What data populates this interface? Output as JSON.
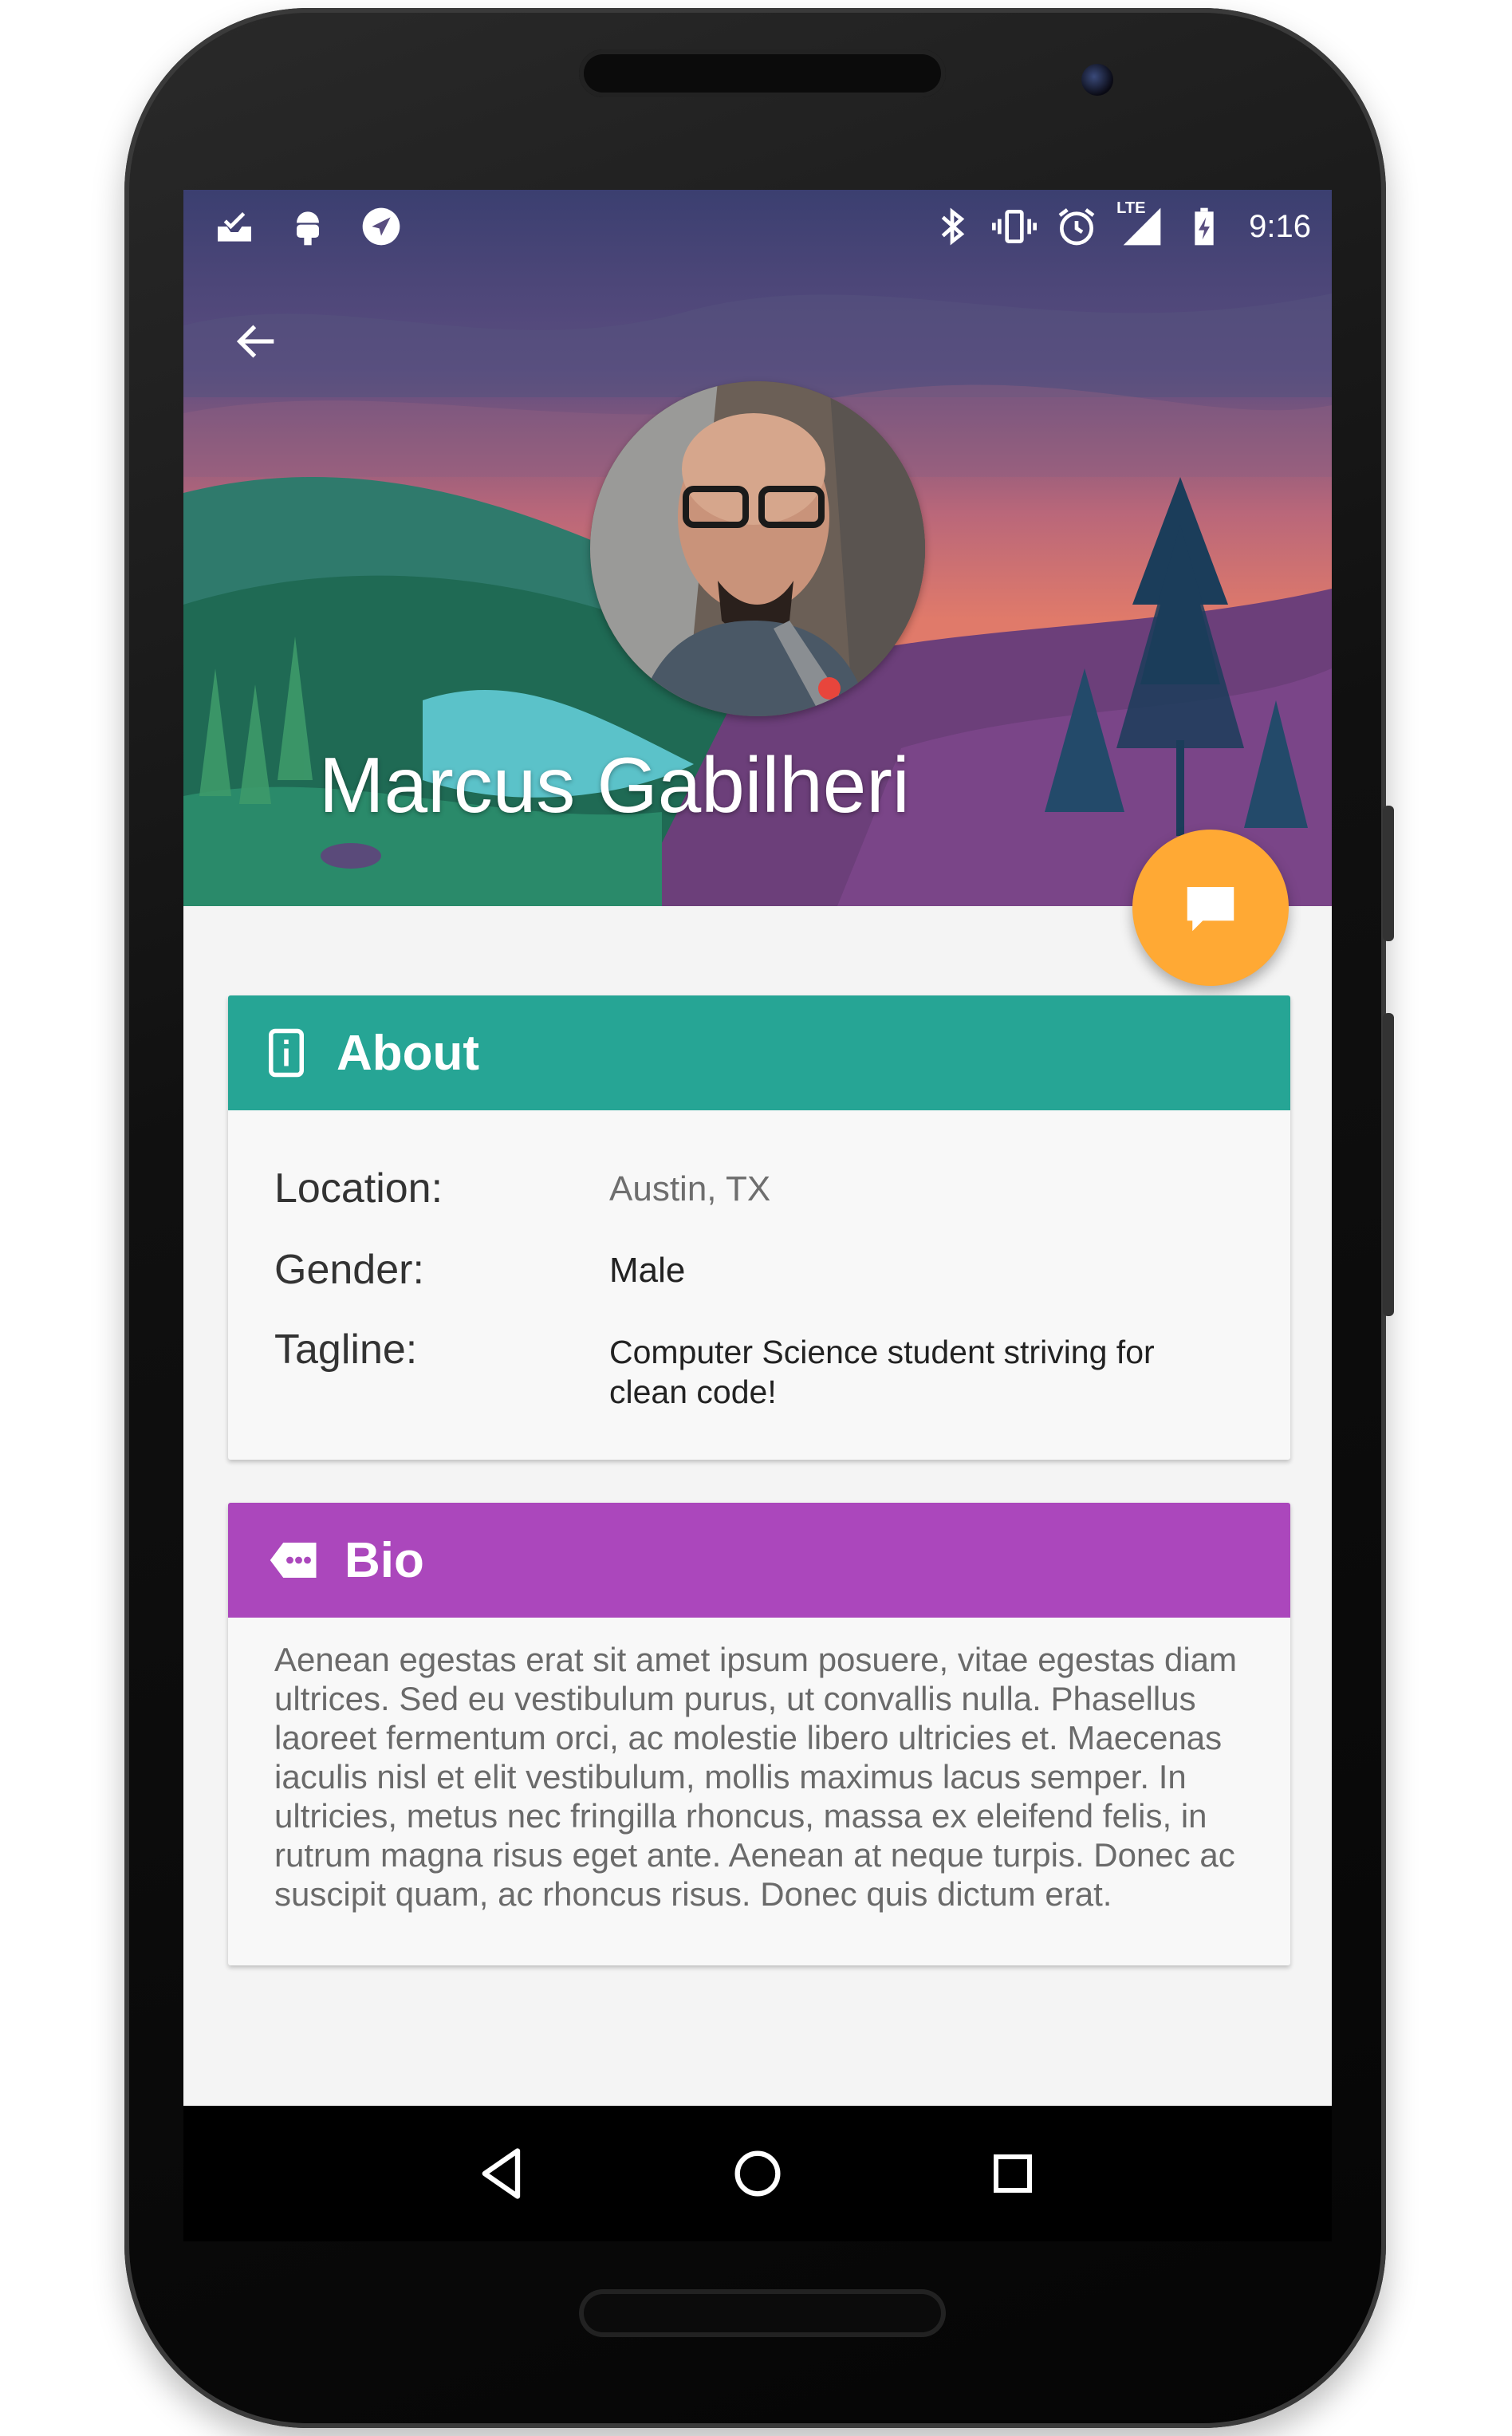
{
  "status_bar": {
    "time": "9:16",
    "left_icons": [
      "inbox-check-icon",
      "android-icon",
      "navigation-icon"
    ],
    "right_icons": [
      "bluetooth-icon",
      "vibrate-icon",
      "alarm-icon",
      "lte-signal-icon",
      "battery-charging-icon"
    ],
    "lte_label": "LTE"
  },
  "header": {
    "back_icon": "arrow-back-icon",
    "name": "Marcus Gabilheri",
    "fab_icon": "chat-bubble-icon"
  },
  "about": {
    "title": "About",
    "icon": "info-card-icon",
    "color": "#26a595",
    "rows": [
      {
        "label": "Location:",
        "value": "Austin, TX"
      },
      {
        "label": "Gender:",
        "value": "Male"
      },
      {
        "label": "Tagline:",
        "value": "Computer Science student striving for clean code!"
      }
    ]
  },
  "bio": {
    "title": "Bio",
    "icon": "comment-tag-icon",
    "color": "#ab47bc",
    "text": "Aenean egestas erat sit amet ipsum posuere, vitae egestas diam ultrices. Sed eu vestibulum purus, ut convallis nulla. Phasellus laoreet fermentum orci, ac molestie libero ultricies et. Maecenas iaculis nisl et elit vestibulum, mollis maximus lacus semper. In ultricies, metus nec fringilla rhoncus, massa ex eleifend felis, in rutrum magna risus eget ante. Aenean at neque turpis. Donec ac suscipit quam, ac rhoncus risus. Donec quis dictum erat."
  },
  "nav": {
    "back": "nav-back-icon",
    "home": "nav-home-icon",
    "recents": "nav-recents-icon"
  },
  "colors": {
    "fab": "#ffa934",
    "screen_bg": "#f4f4f4"
  }
}
